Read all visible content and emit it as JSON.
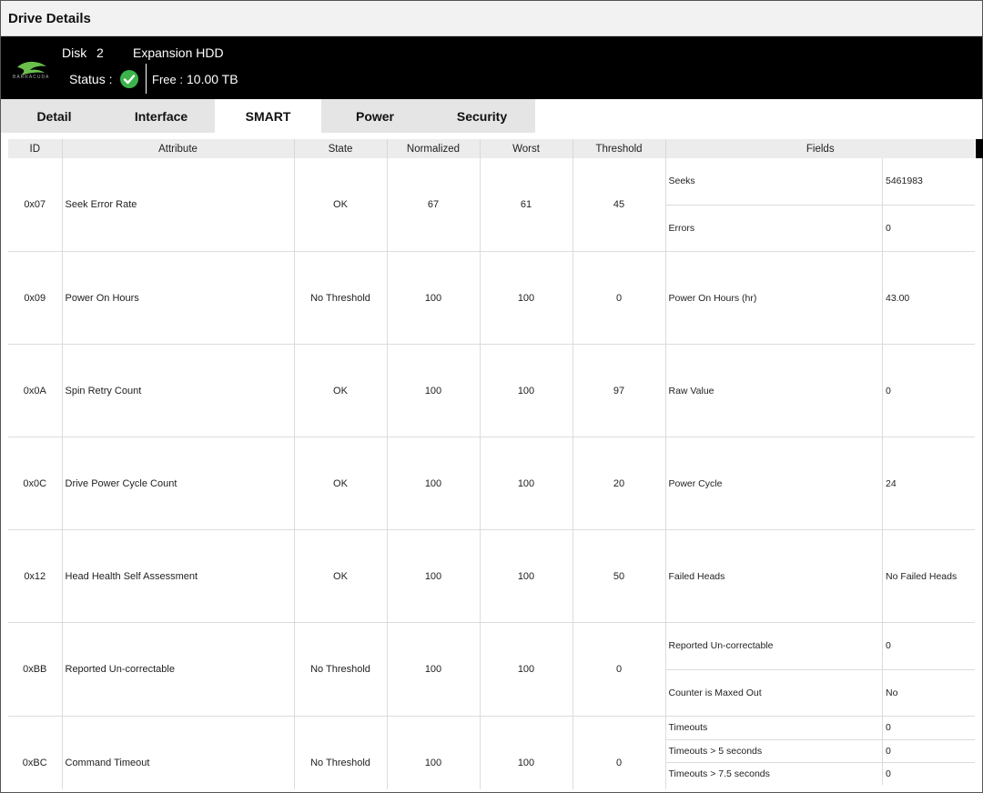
{
  "window": {
    "title": "Drive Details"
  },
  "drive": {
    "brand_text": "BARRACUDA",
    "disk_label": "Disk",
    "disk_number": "2",
    "model": "Expansion HDD",
    "status_label": "Status :",
    "free_label": "Free :",
    "free_value": "10.00 TB",
    "status_color": "#3cb44b"
  },
  "tabs": [
    {
      "label": "Detail",
      "active": false
    },
    {
      "label": "Interface",
      "active": false
    },
    {
      "label": "SMART",
      "active": true
    },
    {
      "label": "Power",
      "active": false
    },
    {
      "label": "Security",
      "active": false
    }
  ],
  "table": {
    "headers": [
      "ID",
      "Attribute",
      "State",
      "Normalized",
      "Worst",
      "Threshold",
      "Fields"
    ],
    "rows": [
      {
        "id": "0x07",
        "attribute": "Seek Error Rate",
        "state": "OK",
        "normalized": "67",
        "worst": "61",
        "threshold": "45",
        "fields": [
          {
            "name": "Seeks",
            "value": "5461983"
          },
          {
            "name": "Errors",
            "value": "0"
          }
        ]
      },
      {
        "id": "0x09",
        "attribute": "Power On Hours",
        "state": "No Threshold",
        "normalized": "100",
        "worst": "100",
        "threshold": "0",
        "fields": [
          {
            "name": "Power On Hours (hr)",
            "value": "43.00"
          }
        ]
      },
      {
        "id": "0x0A",
        "attribute": "Spin Retry Count",
        "state": "OK",
        "normalized": "100",
        "worst": "100",
        "threshold": "97",
        "fields": [
          {
            "name": "Raw Value",
            "value": "0"
          }
        ]
      },
      {
        "id": "0x0C",
        "attribute": "Drive Power Cycle Count",
        "state": "OK",
        "normalized": "100",
        "worst": "100",
        "threshold": "20",
        "fields": [
          {
            "name": "Power Cycle",
            "value": "24"
          }
        ]
      },
      {
        "id": "0x12",
        "attribute": "Head Health Self Assessment",
        "state": "OK",
        "normalized": "100",
        "worst": "100",
        "threshold": "50",
        "fields": [
          {
            "name": "Failed Heads",
            "value": "No Failed Heads"
          }
        ]
      },
      {
        "id": "0xBB",
        "attribute": "Reported Un-correctable",
        "state": "No Threshold",
        "normalized": "100",
        "worst": "100",
        "threshold": "0",
        "fields": [
          {
            "name": "Reported Un-correctable",
            "value": "0"
          },
          {
            "name": "Counter is Maxed Out",
            "value": "No"
          }
        ]
      },
      {
        "id": "0xBC",
        "attribute": "Command Timeout",
        "state": "No Threshold",
        "normalized": "100",
        "worst": "100",
        "threshold": "0",
        "fields": [
          {
            "name": "Timeouts",
            "value": "0"
          },
          {
            "name": "Timeouts > 5 seconds",
            "value": "0"
          },
          {
            "name": "Timeouts > 7.5 seconds",
            "value": "0"
          }
        ]
      }
    ]
  }
}
